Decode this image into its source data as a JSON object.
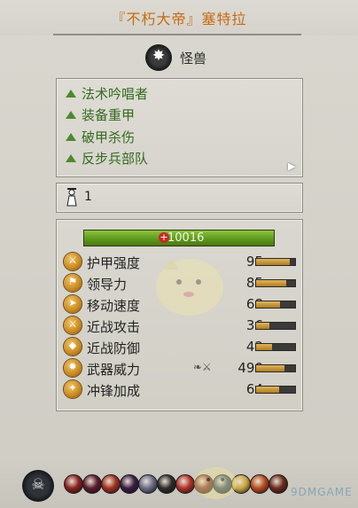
{
  "unit": {
    "title": "『不朽大帝』塞特拉",
    "category_icon": "star-burst-icon",
    "category_glyph": "✸",
    "category": "怪兽"
  },
  "attributes": [
    {
      "label": "法术吟唱者"
    },
    {
      "label": "装备重甲"
    },
    {
      "label": "破甲杀伤"
    },
    {
      "label": "反步兵部队"
    }
  ],
  "attributes_more_glyph": "▶",
  "men": {
    "icon": "soldier-icon",
    "count": "1"
  },
  "health": {
    "value": "10016",
    "plus": "+",
    "fill": 1.0
  },
  "stats": [
    {
      "label": "护甲强度",
      "value": "95",
      "fill": 0.86,
      "icon": "armour-icon",
      "glyph": "⚔"
    },
    {
      "label": "领导力",
      "value": "85",
      "fill": 0.78,
      "icon": "leadership-icon",
      "glyph": "⚑"
    },
    {
      "label": "移动速度",
      "value": "68",
      "fill": 0.62,
      "icon": "speed-icon",
      "glyph": "➤"
    },
    {
      "label": "近战攻击",
      "value": "36",
      "fill": 0.34,
      "icon": "melee-attack-icon",
      "glyph": "⚔"
    },
    {
      "label": "近战防御",
      "value": "42",
      "fill": 0.4,
      "icon": "melee-defence-icon",
      "glyph": "◆"
    },
    {
      "label": "武器威力",
      "value": "490",
      "fill": 0.72,
      "icon": "weapon-strength-icon",
      "glyph": "✹",
      "prefix": "❧⚔"
    },
    {
      "label": "冲锋加成",
      "value": "64",
      "fill": 0.58,
      "icon": "charge-bonus-icon",
      "glyph": "✦"
    }
  ],
  "unit_badge_glyph": "☠",
  "abilities": [
    {
      "icon": "ability-1-icon",
      "color": "#8a1f1f"
    },
    {
      "icon": "ability-2-icon",
      "color": "#5a1a2e"
    },
    {
      "icon": "ability-3-icon",
      "color": "#a0301e"
    },
    {
      "icon": "ability-4-icon",
      "color": "#3a1c44"
    },
    {
      "icon": "ability-5-icon",
      "color": "#6a6a88"
    },
    {
      "icon": "ability-6-icon",
      "color": "#2c2c2c"
    },
    {
      "icon": "ability-7-icon",
      "color": "#b0302a"
    },
    {
      "icon": "ability-8-icon",
      "color": "#7a2424"
    },
    {
      "icon": "ability-9-icon",
      "color": "#25456a"
    },
    {
      "icon": "ability-10-icon",
      "color": "#c9a640"
    },
    {
      "icon": "ability-11-icon",
      "color": "#b84a1e"
    },
    {
      "icon": "ability-12-icon",
      "color": "#6b2a1c"
    }
  ],
  "watermark": "9DMGAME"
}
